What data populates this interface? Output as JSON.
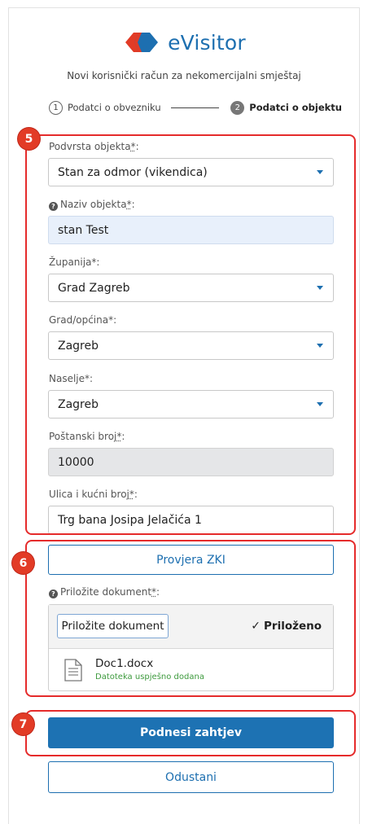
{
  "app": {
    "logo_text": "eVisitor",
    "brand_blue": "#1d6fb0",
    "brand_red": "#e23b26"
  },
  "subtitle": "Novi korisnički račun za nekomercijalni smještaj",
  "steps": [
    {
      "number": "1",
      "label": "Podatci o obvezniku",
      "active": false
    },
    {
      "number": "2",
      "label": "Podatci o objektu",
      "active": true
    }
  ],
  "form": {
    "podvrsta": {
      "label": "Podvrsta objekta",
      "req": "*",
      "suffix": ":",
      "value": "Stan za odmor (vikendica)"
    },
    "naziv": {
      "label": "Naziv objekta",
      "req": "*",
      "suffix": ":",
      "value": "stan Test",
      "help_icon": "question-icon"
    },
    "zupanija": {
      "label": "Županija*:",
      "value": "Grad Zagreb"
    },
    "grad": {
      "label": "Grad/općina*:",
      "value": "Zagreb"
    },
    "naselje": {
      "label": "Naselje*:",
      "value": "Zagreb"
    },
    "postanski": {
      "label": "Poštanski broj",
      "req": "*",
      "suffix": ":",
      "value": "10000"
    },
    "ulica": {
      "label": "Ulica i kućni broj",
      "req": "*",
      "suffix": ":",
      "value": "Trg bana Josipa Jelačića 1"
    }
  },
  "zki_button": "Provjera ZKI",
  "attachment": {
    "label": "Priložite dokument",
    "req": "*",
    "suffix": ":",
    "upload_button": "Priložite dokument",
    "status": "Priloženo",
    "file_name": "Doc1.docx",
    "file_status": "Datoteka uspješno dodana"
  },
  "submit_button": "Podnesi zahtjev",
  "cancel_button": "Odustani",
  "annotations": [
    "5",
    "6",
    "7"
  ]
}
